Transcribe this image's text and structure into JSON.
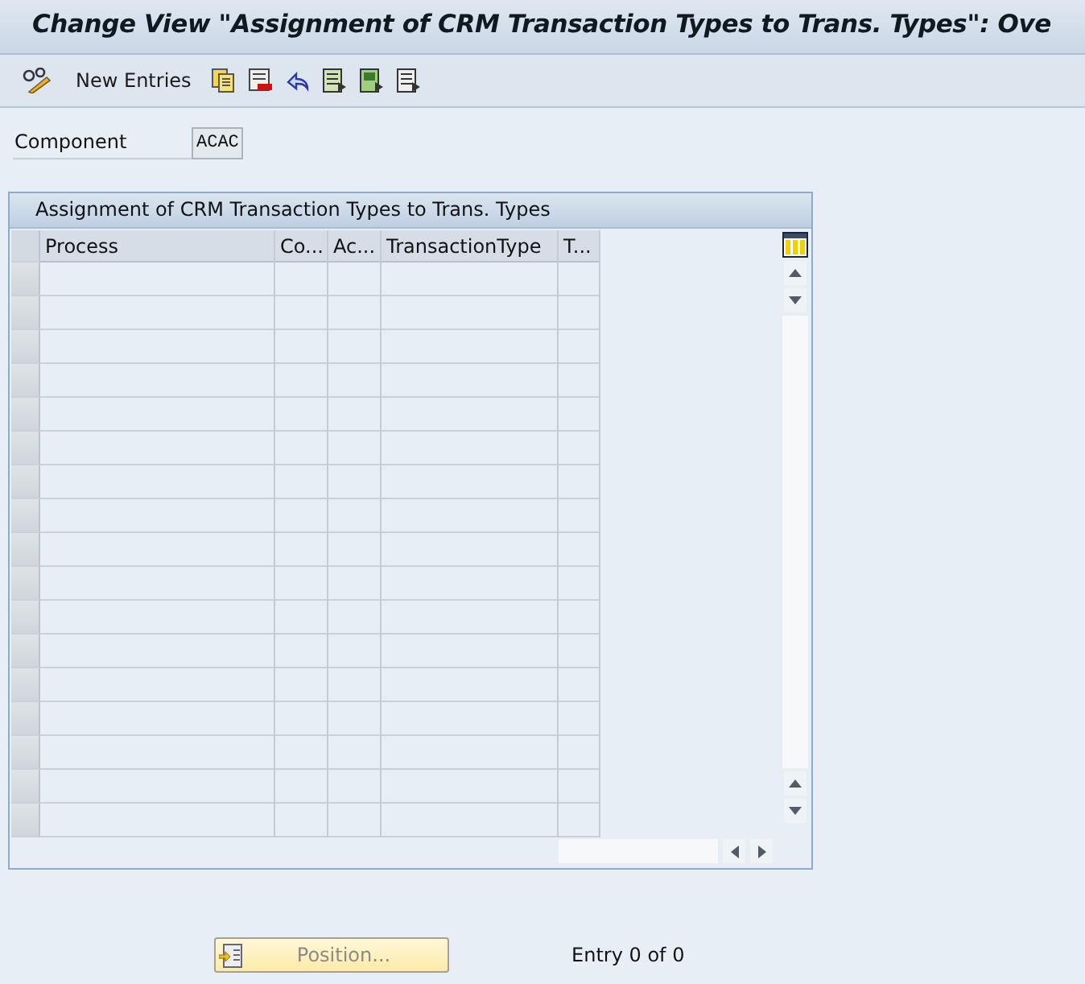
{
  "window": {
    "title": "Change View \"Assignment of CRM Transaction Types to Trans. Types\": Ove"
  },
  "toolbar": {
    "new_entries": "New Entries"
  },
  "component": {
    "label": "Component",
    "value": "ACAC"
  },
  "table": {
    "title": "Assignment of CRM Transaction Types to Trans. Types",
    "columns": [
      {
        "label": "Process"
      },
      {
        "label": "Co..."
      },
      {
        "label": "Ac..."
      },
      {
        "label": "TransactionType"
      },
      {
        "label": "T..."
      }
    ]
  },
  "footer": {
    "position_button": "Position...",
    "entry_info": "Entry 0 of 0"
  }
}
